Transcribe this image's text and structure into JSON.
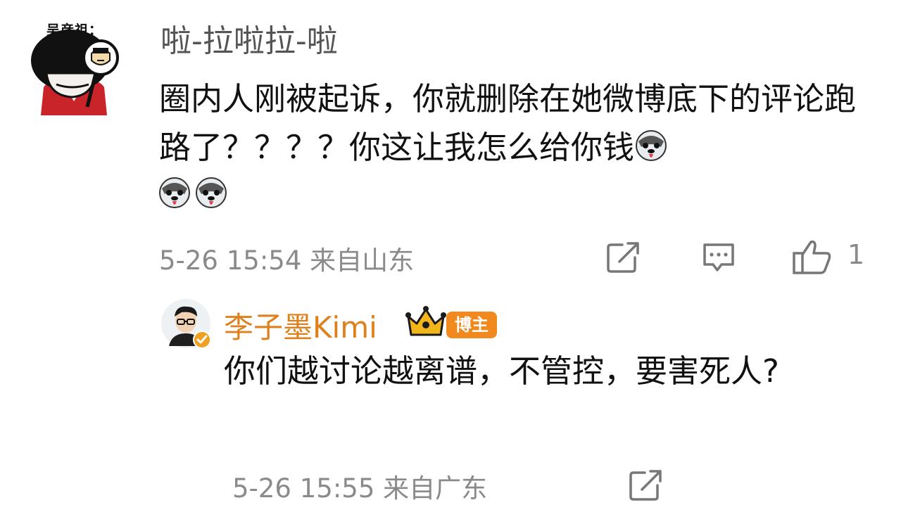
{
  "main_comment": {
    "avatar_caption": "吴彦祖：",
    "username": "啦-拉啦拉-啦",
    "text": "圈内人刚被起诉，你就删除在她微博底下的评论跑路了？？？？你这让我怎么给你钱",
    "trailing_emojis": [
      "husky-dog-emoji",
      "husky-dog-emoji",
      "husky-dog-emoji"
    ],
    "meta": "5-26 15:54 来自山东",
    "actions": {
      "share_icon": "share-icon",
      "reply_icon": "comment-icon",
      "like_icon": "thumbs-up-icon",
      "like_count": "1"
    }
  },
  "reply": {
    "username": "李子墨Kimi",
    "crown_icon": "crown-icon",
    "badge": "博主",
    "verified_icon": "verified-icon",
    "text": "你们越讨论越离谱，不管控，要害死人?",
    "meta": "5-26 15:55 来自广东",
    "actions": {
      "share_icon": "share-icon"
    }
  },
  "colors": {
    "username_reply": "#e0801c",
    "badge_bg": "#f08a1e",
    "meta_gray": "#8a8a8a"
  }
}
